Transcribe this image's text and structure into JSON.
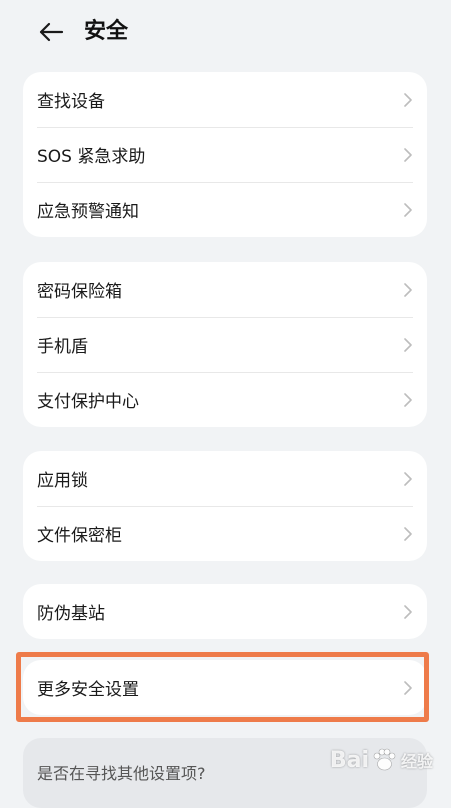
{
  "header": {
    "title": "安全"
  },
  "groups": [
    {
      "items": [
        {
          "label": "查找设备"
        },
        {
          "label": "SOS 紧急求助"
        },
        {
          "label": "应急预警通知"
        }
      ]
    },
    {
      "items": [
        {
          "label": "密码保险箱"
        },
        {
          "label": "手机盾"
        },
        {
          "label": "支付保护中心"
        }
      ]
    },
    {
      "items": [
        {
          "label": "应用锁"
        },
        {
          "label": "文件保密柜"
        }
      ]
    },
    {
      "items": [
        {
          "label": "防伪基站"
        }
      ]
    },
    {
      "items": [
        {
          "label": "更多安全设置"
        }
      ]
    }
  ],
  "suggestion": {
    "text": "是否在寻找其他设置项?"
  },
  "watermark": {
    "brand_left": "Bai",
    "brand_right": "经验"
  },
  "icons": {
    "back": "back-arrow-icon",
    "chevron": "chevron-right-icon"
  },
  "colors": {
    "background": "#f1f3f5",
    "card": "#ffffff",
    "highlight": "#ee7b4a"
  }
}
